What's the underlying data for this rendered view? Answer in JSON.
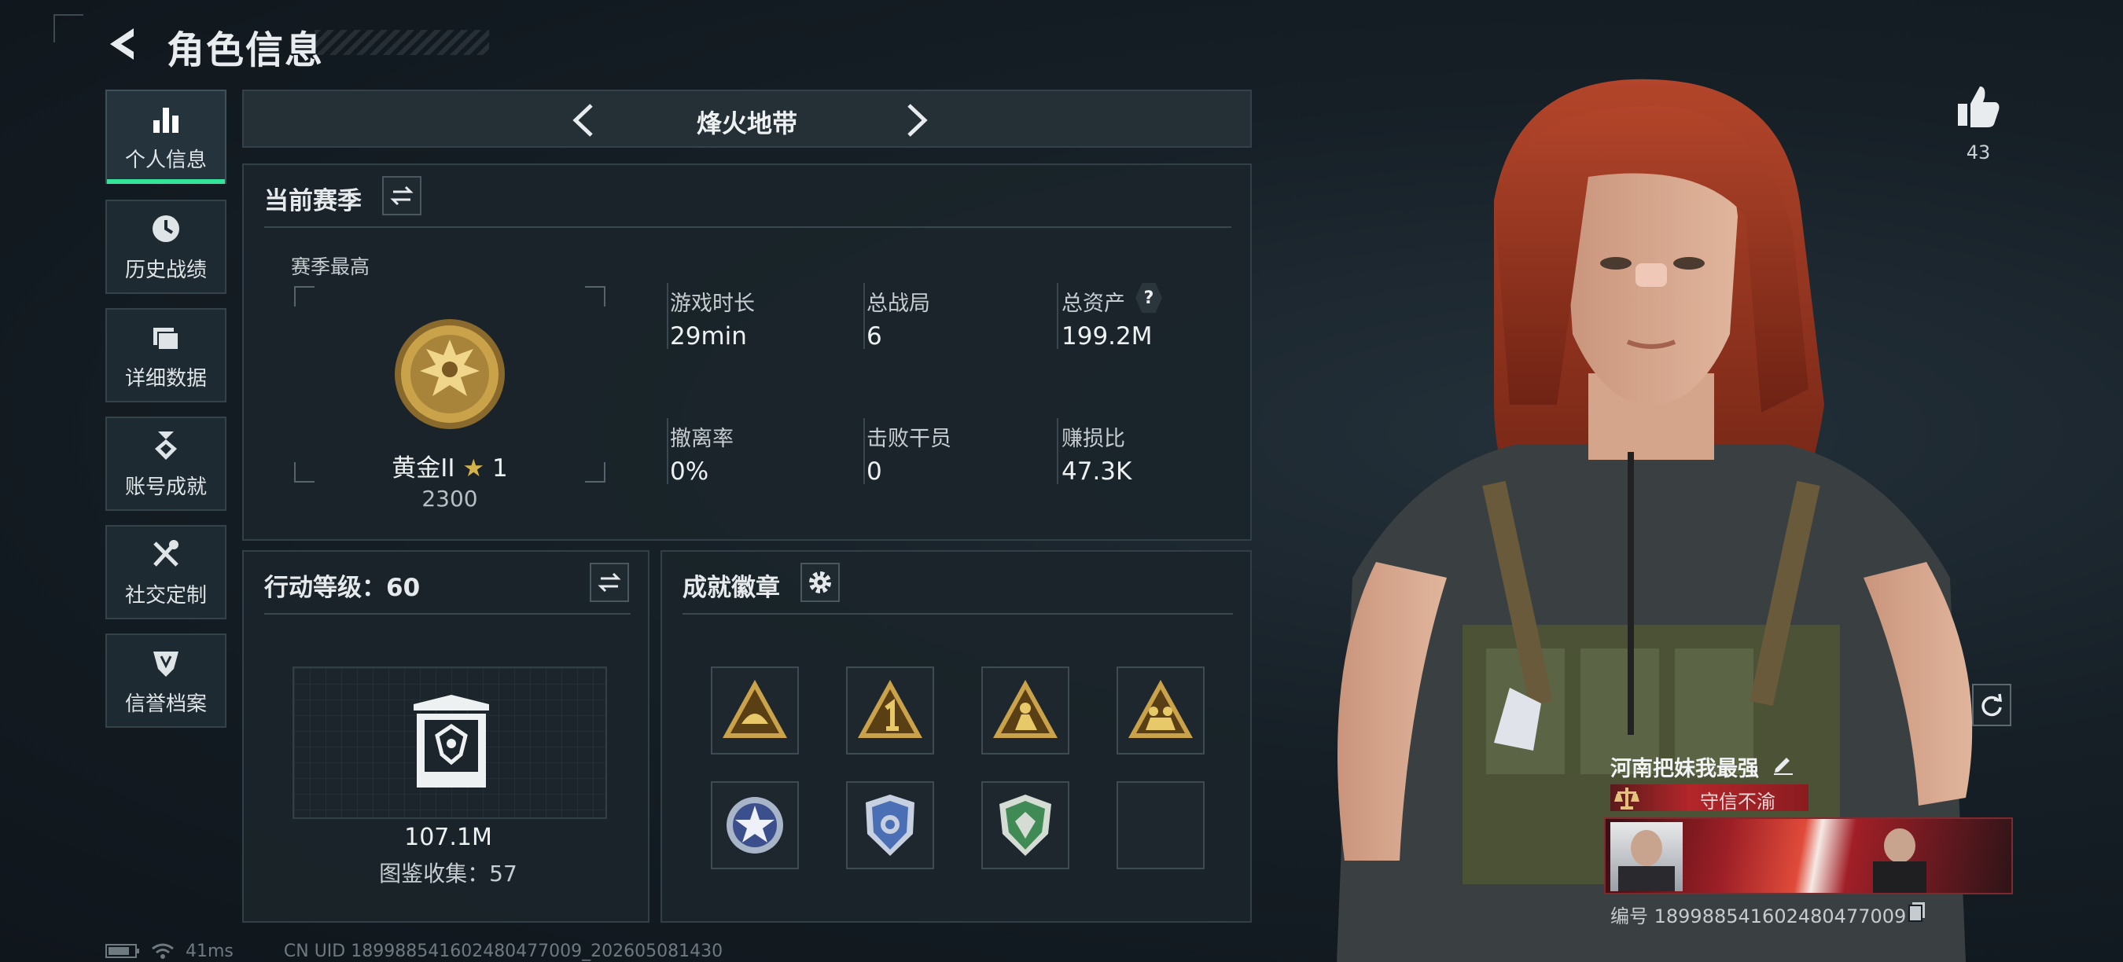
{
  "header": {
    "title": "角色信息"
  },
  "sidebar": {
    "items": [
      {
        "label": "个人信息",
        "icon": "bar-chart-icon",
        "active": true
      },
      {
        "label": "历史战绩",
        "icon": "clock-icon"
      },
      {
        "label": "详细数据",
        "icon": "folder-icon"
      },
      {
        "label": "账号成就",
        "icon": "medal-icon"
      },
      {
        "label": "社交定制",
        "icon": "tools-icon"
      },
      {
        "label": "信誉档案",
        "icon": "shield-icon"
      }
    ]
  },
  "mode_selector": {
    "name": "烽火地带"
  },
  "season": {
    "title": "当前赛季",
    "best_label": "赛季最高",
    "rank_name": "黄金II",
    "rank_stars": "1",
    "rank_points": "2300",
    "stats": [
      {
        "label": "游戏时长",
        "value": "29min"
      },
      {
        "label": "总战局",
        "value": "6"
      },
      {
        "label": "总资产",
        "value": "199.2M",
        "help": "?"
      },
      {
        "label": "撤离率",
        "value": "0%"
      },
      {
        "label": "击败干员",
        "value": "0"
      },
      {
        "label": "赚损比",
        "value": "47.3K"
      }
    ]
  },
  "action_level": {
    "title": "行动等级：60",
    "value_amount": "107.1M",
    "collection": "图鉴收集：57"
  },
  "achievements": {
    "title": "成就徽章",
    "badges": [
      {
        "icon": "triangle-helmet-badge-icon",
        "color": "#c9a24a"
      },
      {
        "icon": "triangle-number-one-badge-icon",
        "color": "#c9a24a"
      },
      {
        "icon": "triangle-soldier-badge-icon",
        "color": "#c9a24a"
      },
      {
        "icon": "triangle-squad-badge-icon",
        "color": "#c9a24a"
      },
      {
        "icon": "silver-star-medal-icon",
        "color": "#a8b4c8"
      },
      {
        "icon": "blue-police-badge-icon",
        "color": "#4b6fb5"
      },
      {
        "icon": "green-shield-badge-icon",
        "color": "#3f8a55"
      },
      {
        "icon": "empty-slot",
        "color": ""
      }
    ]
  },
  "profile": {
    "likes": "43",
    "player_name": "河南把妹我最强",
    "motto": "守信不渝",
    "player_id": "编号 18998854160248047700​9"
  },
  "status_bar": {
    "ping": "41ms",
    "uid": "CN UID 18998854160248047700​9_202605081430"
  },
  "colors": {
    "accent": "#35e39a",
    "gold": "#c9a24a",
    "motto_red": "#b3262a"
  }
}
